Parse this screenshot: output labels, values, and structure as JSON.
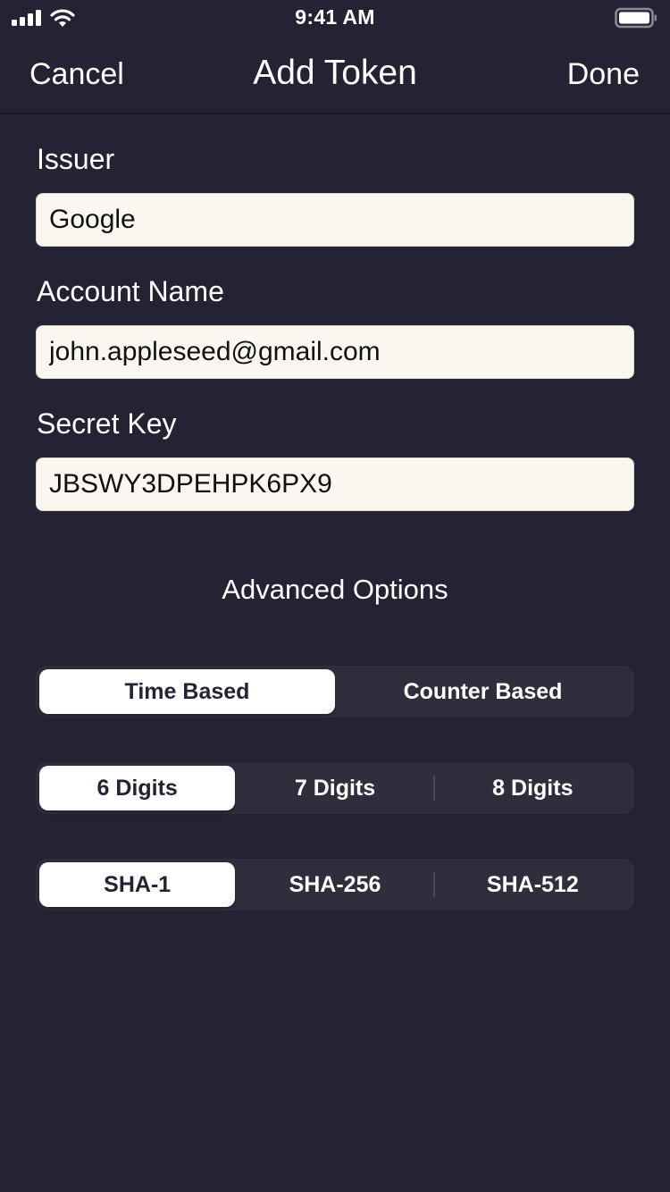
{
  "status_bar": {
    "time": "9:41 AM",
    "icons": [
      "signal-icon",
      "wifi-icon",
      "battery-icon"
    ]
  },
  "nav": {
    "cancel_label": "Cancel",
    "title": "Add Token",
    "done_label": "Done"
  },
  "form": {
    "issuer": {
      "label": "Issuer",
      "value": "Google"
    },
    "account_name": {
      "label": "Account Name",
      "value": "john.appleseed@gmail.com"
    },
    "secret_key": {
      "label": "Secret Key",
      "value": "JBSWY3DPEHPK6PX9"
    }
  },
  "advanced": {
    "title": "Advanced Options",
    "token_type": {
      "options": [
        "Time Based",
        "Counter Based"
      ],
      "selected": "Time Based"
    },
    "digits": {
      "options": [
        "6 Digits",
        "7 Digits",
        "8 Digits"
      ],
      "selected": "6 Digits"
    },
    "algorithm": {
      "options": [
        "SHA-1",
        "SHA-256",
        "SHA-512"
      ],
      "selected": "SHA-1"
    }
  },
  "colors": {
    "background": "#242333",
    "field_background": "#F9F7F0",
    "segment_track": "#2F2E3D",
    "segment_selected": "#FFFFFF"
  }
}
